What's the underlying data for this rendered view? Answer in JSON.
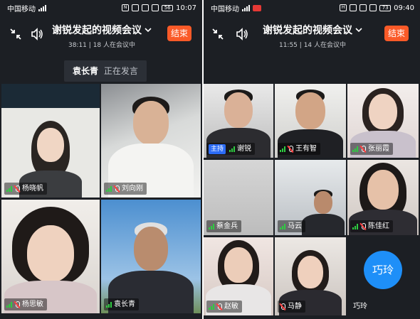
{
  "left": {
    "status": {
      "carrier": "中国移动",
      "battery": "56",
      "time": "10:07"
    },
    "meeting": {
      "title": "谢锐发起的视频会议",
      "duration": "38:11",
      "participants": "18 人在会议中"
    },
    "end_label": "结束",
    "speaker": {
      "name": "袁长青",
      "status": "正在发言"
    },
    "tiles": [
      {
        "name": "杨晓帆"
      },
      {
        "name": "刘向刚"
      },
      {
        "name": "杨思敏"
      },
      {
        "name": "袁长青"
      }
    ]
  },
  "right": {
    "status": {
      "carrier": "中国移动",
      "battery": "73",
      "time": "09:40"
    },
    "meeting": {
      "title": "谢锐发起的视频会议",
      "duration": "11:55",
      "participants": "14 人在会议中"
    },
    "end_label": "结束",
    "host_label": "主持",
    "tiles": [
      {
        "name": "谢锐"
      },
      {
        "name": "王有智"
      },
      {
        "name": "张丽霞"
      },
      {
        "name": "蔡金兵"
      },
      {
        "name": "马云"
      },
      {
        "name": "陈佳红"
      },
      {
        "name": "赵敏"
      },
      {
        "name": "马静"
      },
      {
        "name": "巧玲",
        "avatar_text": "巧玲"
      }
    ]
  },
  "colors": {
    "accent": "#fa5a28",
    "active_speaker": "#2ecc40",
    "host_badge": "#2c6cf6",
    "avatar": "#1e8ff8"
  },
  "icons": [
    "signal-icon",
    "minimize-icon",
    "speaker-icon",
    "chevron-down-icon",
    "mic-muted-icon",
    "volume-icon"
  ]
}
